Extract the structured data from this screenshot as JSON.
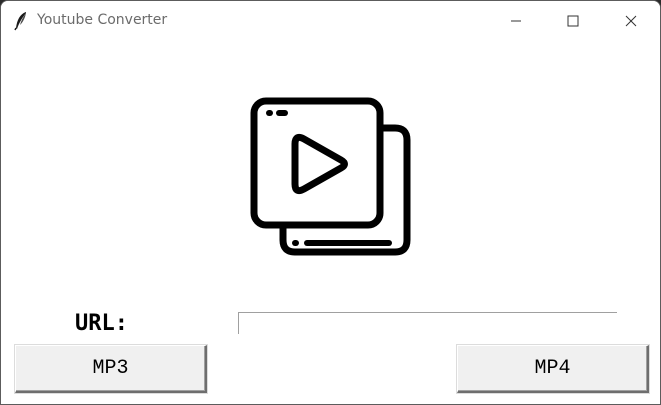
{
  "window": {
    "title": "Youtube Converter",
    "app_icon": "feather-icon",
    "controls": {
      "minimize_icon": "minimize-icon",
      "maximize_icon": "maximize-icon",
      "close_icon": "close-icon"
    }
  },
  "main": {
    "hero_icon": "video-player-icon",
    "url_label": "URL:",
    "url_input_value": "",
    "mp3_button": "MP3",
    "mp4_button": "MP4"
  }
}
